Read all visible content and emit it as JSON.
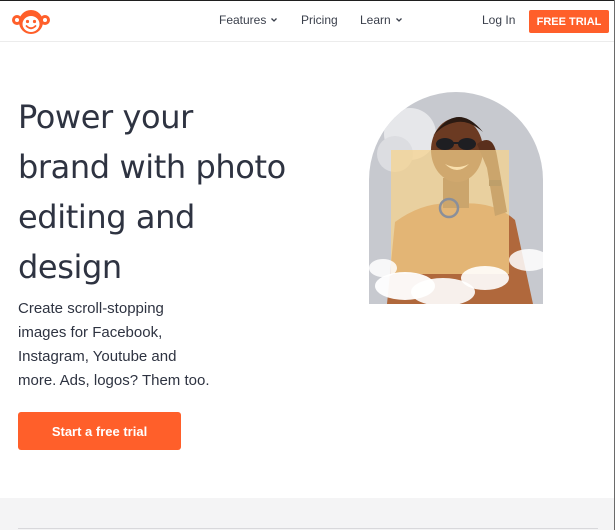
{
  "header": {
    "logo_icon": "monkey-logo-icon",
    "nav": [
      {
        "label": "Features",
        "has_dropdown": true
      },
      {
        "label": "Pricing",
        "has_dropdown": false
      },
      {
        "label": "Learn",
        "has_dropdown": true
      }
    ],
    "login_label": "Log In",
    "trial_label": "FREE TRIAL"
  },
  "hero": {
    "title_lines": [
      "Power your",
      "brand with photo",
      "editing and",
      "design"
    ],
    "subtitle_lines": [
      "Create scroll-stopping",
      "images for Facebook,",
      "Instagram, Youtube and",
      "more. Ads, logos? Them too."
    ],
    "cta_label": "Start a free trial"
  },
  "colors": {
    "accent": "#ff5f2a",
    "text": "#2e3341",
    "image_bg": "#c7c9cf",
    "image_overlay": "#f7d28c"
  }
}
